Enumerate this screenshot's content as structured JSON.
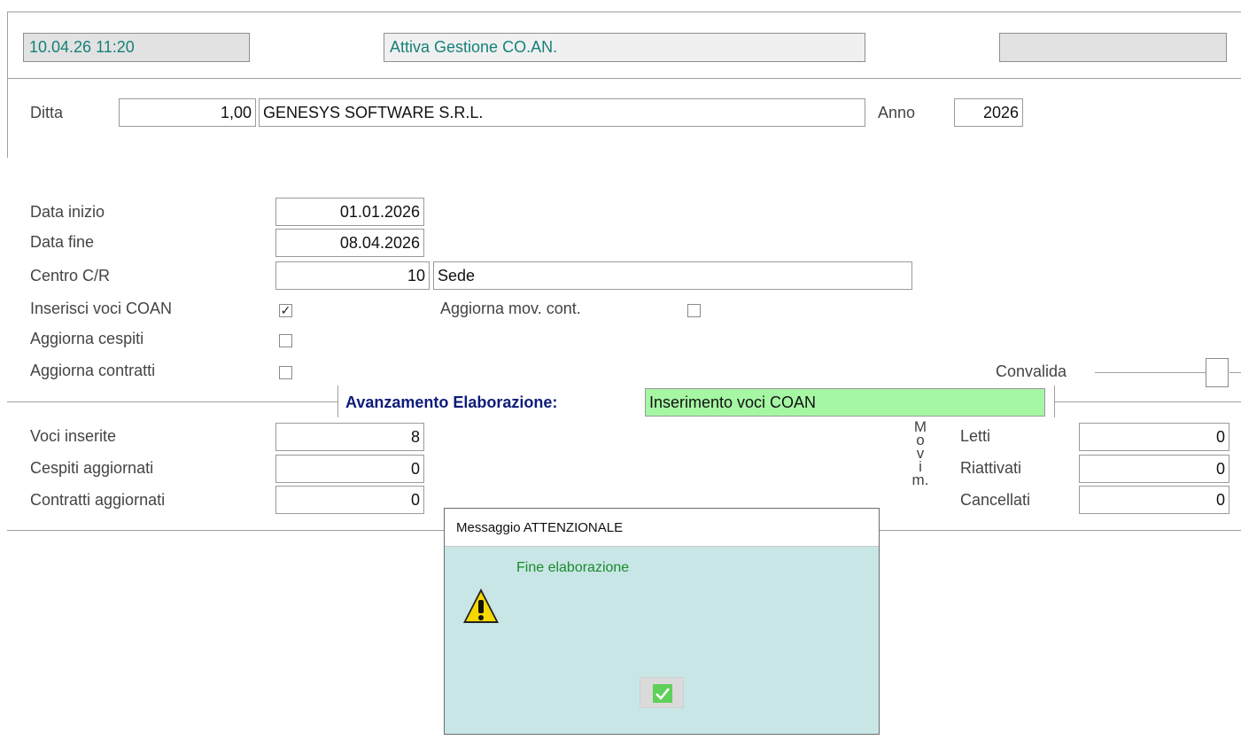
{
  "header": {
    "datetime": "10.04.26 11:20",
    "program_title": "Attiva Gestione CO.AN.",
    "right_status": ""
  },
  "company": {
    "ditta_label": "Ditta",
    "ditta_code": "1,00",
    "ditta_name": "GENESYS SOFTWARE S.R.L.",
    "anno_label": "Anno",
    "anno_value": "2026"
  },
  "params": {
    "data_inizio_label": "Data inizio",
    "data_inizio": "01.01.2026",
    "data_fine_label": "Data fine",
    "data_fine": "08.04.2026",
    "centro_label": "Centro C/R",
    "centro_code": "10",
    "centro_name": "Sede",
    "inserisci_label": "Inserisci voci COAN",
    "inserisci_checked": true,
    "aggiorna_mov_label": "Aggiorna mov. cont.",
    "aggiorna_mov_checked": false,
    "aggiorna_cespiti_label": "Aggiorna cespiti",
    "aggiorna_cespiti_checked": false,
    "aggiorna_contratti_label": "Aggiorna contratti",
    "aggiorna_contratti_checked": false,
    "convalida_label": "Convalida"
  },
  "progress": {
    "title": "Avanzamento Elaborazione:",
    "value": "Inserimento voci COAN"
  },
  "results": {
    "voci_label": "Voci inserite",
    "voci": "8",
    "cespiti_label": "Cespiti aggiornati",
    "cespiti": "0",
    "contratti_label": "Contratti aggiornati",
    "contratti": "0",
    "movim_letters": [
      "M",
      "o",
      "v",
      "i",
      "m."
    ],
    "letti_label": "Letti",
    "letti": "0",
    "riattivati_label": "Riattivati",
    "riattivati": "0",
    "cancellati_label": "Cancellati",
    "cancellati": "0"
  },
  "dialog": {
    "title": "Messaggio ATTENZIONALE",
    "message": "Fine elaborazione",
    "icon": "warning-icon",
    "ok_icon": "check-icon"
  }
}
